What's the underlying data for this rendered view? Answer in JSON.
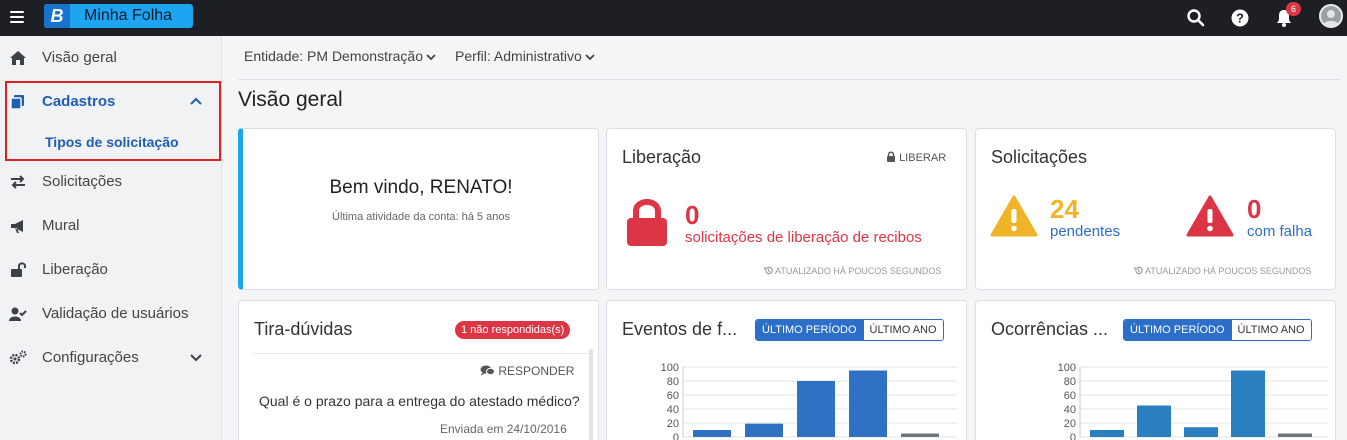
{
  "app": {
    "logo_letter": "B",
    "name": "Minha Folha",
    "notifications_count": "6"
  },
  "topbar_icons": [
    "search-icon",
    "help-icon",
    "bell-icon",
    "avatar"
  ],
  "sidebar": {
    "items": [
      {
        "label": "Visão geral",
        "icon": "home-icon"
      },
      {
        "label": "Cadastros",
        "icon": "copy-icon",
        "expanded": true,
        "subitems": [
          {
            "label": "Tipos de solicitação"
          }
        ]
      },
      {
        "label": "Solicitações",
        "icon": "exchange-icon"
      },
      {
        "label": "Mural",
        "icon": "megaphone-icon"
      },
      {
        "label": "Liberação",
        "icon": "unlock-icon"
      },
      {
        "label": "Validação de usuários",
        "icon": "user-check-icon"
      },
      {
        "label": "Configurações",
        "icon": "gears-icon"
      }
    ]
  },
  "filters": {
    "entity": "Entidade: PM Demonstração",
    "profile": "Perfil: Administrativo"
  },
  "page_title": "Visão geral",
  "welcome": {
    "title": "Bem vindo, RENATO!",
    "subtitle": "Última atividade da conta: há 5 anos"
  },
  "release": {
    "title": "Liberação",
    "action": "LIBERAR",
    "count": "0",
    "label": "solicitações de liberação de recibos",
    "updated": "ATUALIZADO HÁ POUCOS SEGUNDOS",
    "color": "#dc3545"
  },
  "requests": {
    "title": "Solicitações",
    "pending_count": "24",
    "pending_label": "pendentes",
    "failed_count": "0",
    "failed_label": "com falha",
    "updated": "ATUALIZADO HÁ POUCOS SEGUNDOS",
    "pending_color": "#f0b429",
    "failed_color": "#dc3545"
  },
  "faq": {
    "title": "Tira-dúvidas",
    "badge": "1 não respondidas(s)",
    "reply": "RESPONDER",
    "question": "Qual é o prazo para a entrega do atestado médico?",
    "sent": "Enviada em 24/10/2016"
  },
  "events": {
    "title": "Eventos de f...",
    "seg_on": "ÚLTIMO PERÍODO",
    "seg_off": "ÚLTIMO ANO"
  },
  "occurrences": {
    "title": "Ocorrências ...",
    "seg_on": "ÚLTIMO PERÍODO",
    "seg_off": "ÚLTIMO ANO"
  },
  "chart_data": [
    {
      "type": "bar",
      "name": "events",
      "ylim": [
        0,
        100
      ],
      "yticks": [
        "0",
        "20",
        "40",
        "60",
        "80",
        "100"
      ],
      "values": [
        10,
        19,
        80,
        95,
        5
      ],
      "bar_colors": [
        "#2f72c4",
        "#2f72c4",
        "#2f72c4",
        "#2f72c4",
        "#6c757d"
      ]
    },
    {
      "type": "bar",
      "name": "occurrences",
      "ylim": [
        0,
        100
      ],
      "yticks": [
        "0",
        "20",
        "40",
        "60",
        "80",
        "100"
      ],
      "values": [
        10,
        45,
        14,
        95,
        5
      ],
      "bar_colors": [
        "#2a7fc0",
        "#2a7fc0",
        "#2a7fc0",
        "#2a7fc0",
        "#6c757d"
      ]
    }
  ]
}
